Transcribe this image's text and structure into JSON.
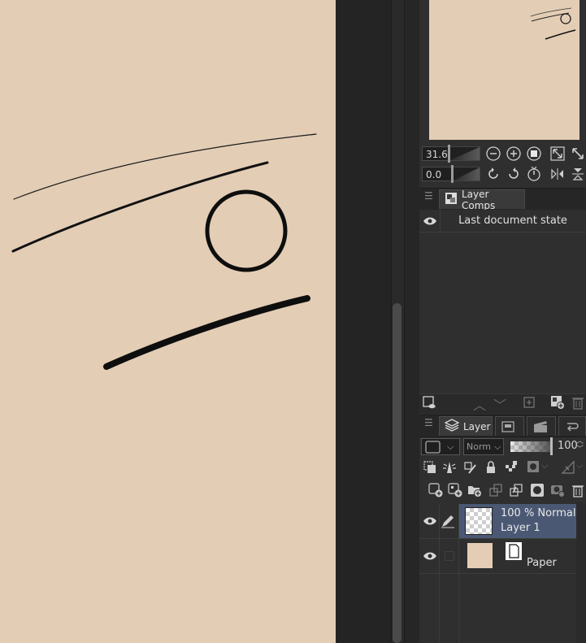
{
  "navigator": {
    "zoom_value": "31.6",
    "rotation_value": "0.0"
  },
  "layer_comps": {
    "tab_label": "Layer Comps",
    "items": [
      {
        "label": "Last document state"
      }
    ]
  },
  "layer_panel": {
    "tab_label": "Layer",
    "blend_mode": "Norm",
    "opacity_value": "100",
    "layers": [
      {
        "info": "100 % Normal",
        "name": "Layer 1",
        "selected": true
      },
      {
        "info": "",
        "name": "Paper",
        "selected": false
      }
    ]
  },
  "colors": {
    "paper": "#e3cdb5",
    "panel_bg": "#2f2f2f",
    "selected_row": "#4a5874"
  }
}
